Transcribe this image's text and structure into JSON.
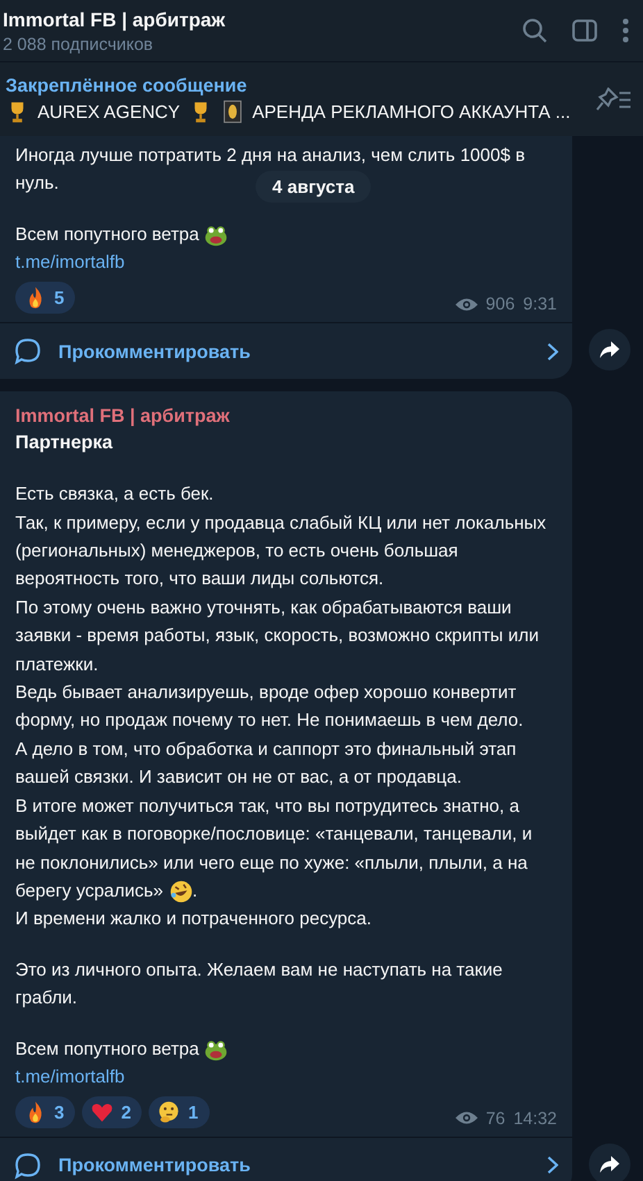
{
  "header": {
    "title": "Immortal FB | арбитраж",
    "subtitle": "2 088 подписчиков"
  },
  "pinned": {
    "label": "Закреплённое сообщение",
    "parts": [
      {
        "kind": "trophy"
      },
      {
        "kind": "text",
        "text": "AUREX AGENCY"
      },
      {
        "kind": "trophy"
      },
      {
        "kind": "card"
      },
      {
        "kind": "text",
        "text": "АРЕНДА РЕКЛАМНОГО АККАУНТА ..."
      }
    ]
  },
  "date_chip": "4 августа",
  "messages": [
    {
      "blocks": [
        [
          [
            {
              "kind": "text",
              "text": "Иногда лучше потратить 2 дня на анализ, чем слить 1000$ в"
            }
          ],
          [
            {
              "kind": "text",
              "text": "нуль."
            }
          ]
        ],
        [
          [
            {
              "kind": "text",
              "text": "Всем попутного ветра"
            },
            {
              "kind": "frog"
            }
          ]
        ]
      ],
      "link": "t.me/imortalfb",
      "reactions": [
        {
          "kind": "fire",
          "count": "5"
        }
      ],
      "views": "906",
      "time": "9:31",
      "comment": "Прокомментировать"
    },
    {
      "author": "Immortal FB | арбитраж",
      "title": "Партнерка",
      "blocks": [
        [
          [
            {
              "kind": "text",
              "text": "Есть связка, а есть бек."
            }
          ],
          [
            {
              "kind": "text",
              "text": "Так, к примеру, если у продавца слабый КЦ или нет локальных (региональных) менеджеров, то есть очень большая вероятность того, что ваши лиды сольются."
            }
          ],
          [
            {
              "kind": "text",
              "text": "По этому очень важно уточнять, как обрабатываются ваши заявки - время работы, язык, скорость, возможно скрипты или платежки."
            }
          ],
          [
            {
              "kind": "text",
              "text": "Ведь бывает анализируешь, вроде офер хорошо конвертит форму, но продаж почему то нет. Не понимаешь в чем дело."
            }
          ],
          [
            {
              "kind": "text",
              "text": "А дело в том, что обработка и саппорт это финальный этап вашей связки. И зависит он не от вас, а от продавца."
            }
          ],
          [
            {
              "kind": "text",
              "text": "В итоге может получиться так, что вы потрудитесь знатно, а выйдет как в поговорке/пословице: «танцевали, танцевали, и не поклонились» или чего еще по хуже: «плыли, плыли, а на"
            }
          ],
          [
            {
              "kind": "text",
              "text": "берегу усрались»"
            },
            {
              "kind": "rofl"
            },
            {
              "kind": "text",
              "text": "."
            }
          ],
          [
            {
              "kind": "text",
              "text": "И времени жалко и потраченного ресурса."
            }
          ]
        ],
        [
          [
            {
              "kind": "text",
              "text": "Это из личного опыта. Желаем вам не наступать на такие грабли."
            }
          ]
        ],
        [
          [
            {
              "kind": "text",
              "text": "Всем попутного ветра"
            },
            {
              "kind": "frog"
            }
          ]
        ]
      ],
      "link": "t.me/imortalfb",
      "reactions": [
        {
          "kind": "fire",
          "count": "3"
        },
        {
          "kind": "heart",
          "count": "2"
        },
        {
          "kind": "thinking",
          "count": "1"
        }
      ],
      "views": "76",
      "time": "14:32",
      "comment": "Прокомментировать"
    }
  ]
}
